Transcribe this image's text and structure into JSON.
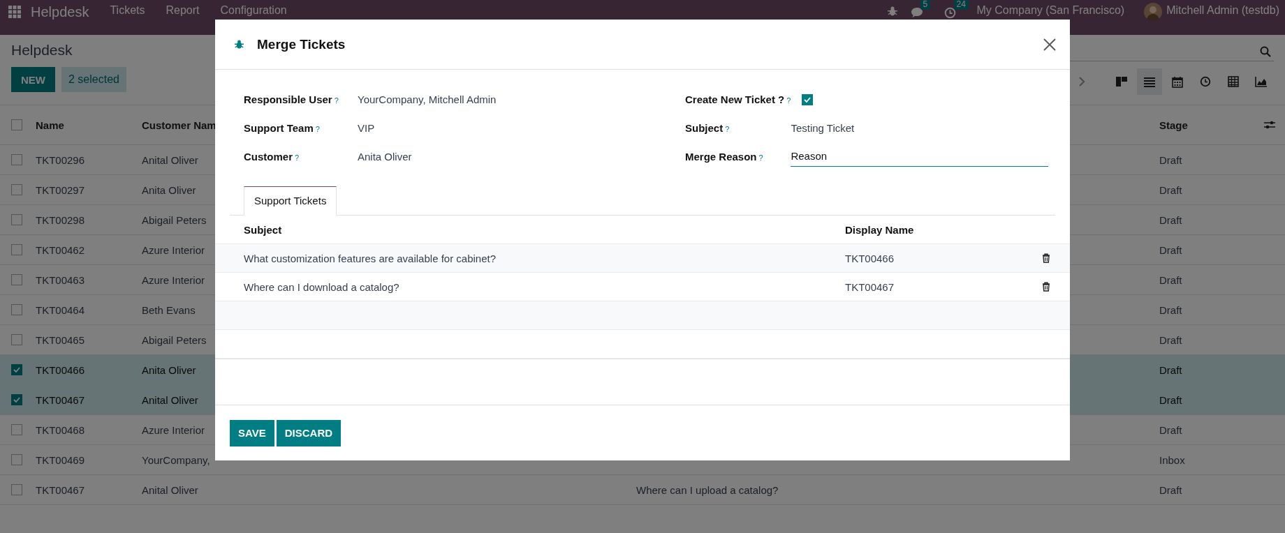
{
  "navbar": {
    "app_name": "Helpdesk",
    "menu": [
      "Tickets",
      "Report",
      "Configuration"
    ],
    "messages_count": "5",
    "activities_count": "24",
    "company": "My Company (San Francisco)",
    "user": "Mitchell Admin (testdb)"
  },
  "control_panel": {
    "breadcrumb": "Helpdesk",
    "new_button": "NEW",
    "selection": "2 selected",
    "views": [
      {
        "kind": "kanban",
        "selected": false
      },
      {
        "kind": "list",
        "selected": true
      },
      {
        "kind": "calendar",
        "selected": false
      },
      {
        "kind": "activity",
        "selected": false
      },
      {
        "kind": "pivot",
        "selected": false
      },
      {
        "kind": "graph",
        "selected": false
      }
    ]
  },
  "list": {
    "columns": [
      "Name",
      "Customer Nam",
      "Stage"
    ],
    "all_checked": false,
    "rows": [
      {
        "name": "TKT00296",
        "customer": "Anital Oliver",
        "stage": "Draft",
        "selected": false
      },
      {
        "name": "TKT00297",
        "customer": "Anita Oliver",
        "stage": "Draft",
        "selected": false
      },
      {
        "name": "TKT00298",
        "customer": "Abigail Peters",
        "stage": "Draft",
        "selected": false
      },
      {
        "name": "TKT00462",
        "customer": "Azure Interior",
        "stage": "Draft",
        "selected": false
      },
      {
        "name": "TKT00463",
        "customer": "Azure Interior",
        "stage": "Draft",
        "selected": false
      },
      {
        "name": "TKT00464",
        "customer": "Beth Evans",
        "stage": "Draft",
        "selected": false
      },
      {
        "name": "TKT00465",
        "customer": "Abigail Peters",
        "stage": "Draft",
        "selected": false
      },
      {
        "name": "TKT00466",
        "customer": "Anita Oliver",
        "stage": "Draft",
        "selected": true
      },
      {
        "name": "TKT00467",
        "customer": "Anital Oliver",
        "stage": "Draft",
        "selected": true
      },
      {
        "name": "TKT00468",
        "customer": "Azure Interior",
        "stage": "Draft",
        "selected": false
      },
      {
        "name": "TKT00469",
        "customer": "YourCompany,",
        "stage": "Inbox",
        "selected": false
      },
      {
        "name": "TKT00467",
        "customer": "Anital Oliver",
        "column_3": "Where can I upload a catalog?",
        "stage": "Draft",
        "selected": false
      }
    ]
  },
  "modal": {
    "title": "Merge Tickets",
    "fields_left": [
      {
        "label": "Responsible User",
        "help": "?",
        "value": "YourCompany, Mitchell Admin"
      },
      {
        "label": "Support Team",
        "help": "?",
        "value": "VIP"
      },
      {
        "label": "Customer",
        "help": "?",
        "value": "Anita Oliver"
      }
    ],
    "fields_right": [
      {
        "kind": "checkbox",
        "label": "Create New Ticket ?",
        "help": "?",
        "checked": true
      },
      {
        "kind": "text",
        "label": "Subject",
        "help": "?",
        "value": "Testing Ticket"
      },
      {
        "kind": "input",
        "label": "Merge Reason",
        "help": "?",
        "value": "Reason"
      }
    ],
    "tabs": [
      {
        "label": "Support Tickets",
        "selected": true
      }
    ],
    "tickets_table": {
      "columns": [
        "Subject",
        "Display Name"
      ],
      "rows": [
        {
          "subject": "What customization features are available for cabinet?",
          "display_name": "TKT00466"
        },
        {
          "subject": "Where can I download a catalog?",
          "display_name": "TKT00467"
        }
      ]
    },
    "buttons": [
      "SAVE",
      "DISCARD"
    ]
  }
}
